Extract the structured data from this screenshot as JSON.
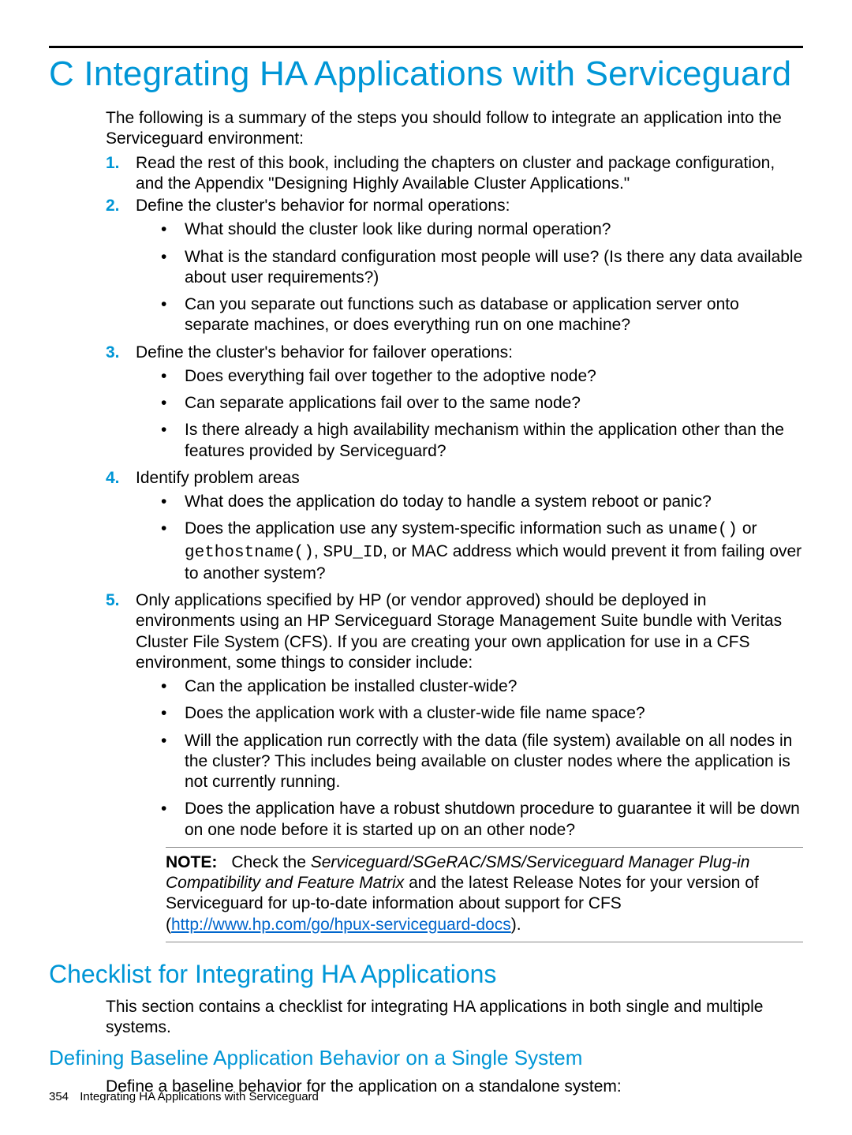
{
  "title": "C Integrating HA Applications with Serviceguard",
  "intro": "The following is a summary of the steps you should follow to integrate an application into the Serviceguard environment:",
  "steps": {
    "s1": {
      "num": "1.",
      "text": "Read the rest of this book, including the chapters on cluster and package configuration, and the Appendix \"Designing Highly Available Cluster Applications.\""
    },
    "s2": {
      "num": "2.",
      "text": "Define the cluster's behavior for normal operations:",
      "b1": "What should the cluster look like during normal operation?",
      "b2": "What is the standard configuration most people will use? (Is there any data available about user requirements?)",
      "b3": "Can you separate out functions such as database or application server onto separate machines, or does everything run on one machine?"
    },
    "s3": {
      "num": "3.",
      "text": "Define the cluster's behavior for failover operations:",
      "b1": "Does everything fail over together to the adoptive node?",
      "b2": "Can separate applications fail over to the same node?",
      "b3": "Is there already a high availability mechanism within the application other than the features provided by Serviceguard?"
    },
    "s4": {
      "num": "4.",
      "text": "Identify problem areas",
      "b1": "What does the application do today to handle a system reboot or panic?",
      "b2_pre": "Does the application use any system-specific information such as ",
      "b2_code1": "uname()",
      "b2_mid1": " or ",
      "b2_code2": "gethostname()",
      "b2_mid2": ", ",
      "b2_code3": "SPU_ID",
      "b2_post": ", or MAC address which would prevent it from failing over to another system?"
    },
    "s5": {
      "num": "5.",
      "text": "Only applications specified by HP (or vendor approved) should be deployed in environments using an HP Serviceguard Storage Management Suite bundle with Veritas Cluster File System (CFS). If you are creating your own application for use in a CFS environment, some things to consider include:",
      "b1": "Can the application be installed cluster-wide?",
      "b2": "Does the application work with a cluster-wide file name space?",
      "b3": "Will the application run correctly with the data (file system) available on all nodes in the cluster? This includes being available on cluster nodes where the application is not currently running.",
      "b4": "Does the application have a robust shutdown procedure to guarantee it will be down on one node before it is started up on an other node?"
    }
  },
  "note": {
    "label": "NOTE:",
    "pre": "Check the ",
    "italic": "Serviceguard/SGeRAC/SMS/Serviceguard Manager Plug-in Compatibility and Feature Matrix",
    "mid": " and the latest Release Notes for your version of Serviceguard for up-to-date information about support for CFS (",
    "link_text": "http://www.hp.com/go/hpux-serviceguard-docs",
    "link_href": "http://www.hp.com/go/hpux-serviceguard-docs",
    "post": ")."
  },
  "h2": "Checklist for Integrating HA Applications",
  "h2_body": "This section contains a checklist for integrating HA applications in both single and multiple systems.",
  "h3": "Defining Baseline Application Behavior on a Single System",
  "h3_body": "Define a baseline behavior for the application on a standalone system:",
  "footer": {
    "page": "354",
    "title": "Integrating HA Applications with Serviceguard"
  }
}
